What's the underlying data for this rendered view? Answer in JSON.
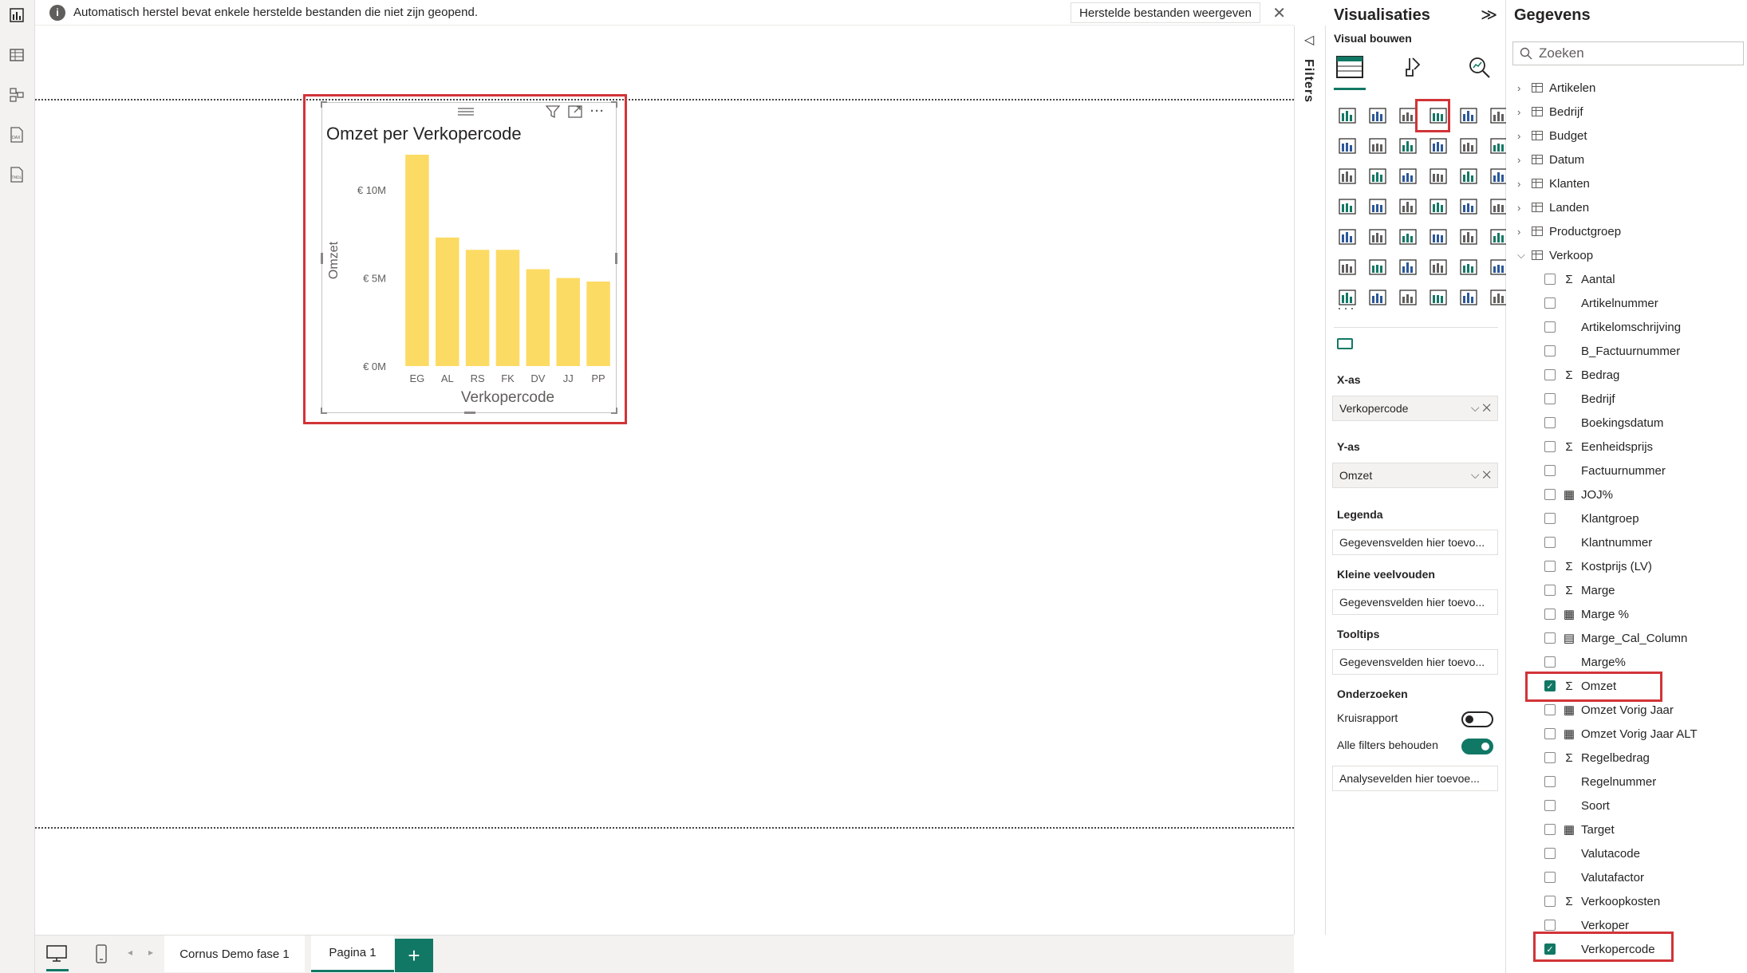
{
  "infobar": {
    "message": "Automatisch herstel bevat enkele herstelde bestanden die niet zijn geopend.",
    "restore_label": "Herstelde bestanden weergeven"
  },
  "visual": {
    "title": "Omzet per Verkopercode"
  },
  "chart_data": {
    "type": "bar",
    "title": "Omzet per Verkopercode",
    "xlabel": "Verkopercode",
    "ylabel": "Omzet",
    "categories": [
      "EG",
      "AL",
      "RS",
      "FK",
      "DV",
      "JJ",
      "PP"
    ],
    "values": [
      12000000,
      7300000,
      6600000,
      6600000,
      5500000,
      5000000,
      4800000
    ],
    "y_ticks": [
      "€ 0M",
      "€ 5M",
      "€ 10M"
    ],
    "ylim": [
      0,
      12000000
    ],
    "color": "#FCDB65",
    "grid": false
  },
  "filters": {
    "label": "Filters"
  },
  "visualizations": {
    "title": "Visualisaties",
    "subtitle": "Visual bouwen",
    "xaxis_label": "X-as",
    "xaxis_value": "Verkopercode",
    "yaxis_label": "Y-as",
    "yaxis_value": "Omzet",
    "legend_label": "Legenda",
    "legend_placeholder": "Gegevensvelden hier toevo...",
    "small_multiples_label": "Kleine veelvouden",
    "small_multiples_placeholder": "Gegevensvelden hier toevo...",
    "tooltips_label": "Tooltips",
    "tooltips_placeholder": "Gegevensvelden hier toevo...",
    "drill_label": "Onderzoeken",
    "cross_report_label": "Kruisrapport",
    "cross_report_on": false,
    "keep_filters_label": "Alle filters behouden",
    "keep_filters_on": true,
    "drill_placeholder": "Analysevelden hier toevoe..."
  },
  "data_pane": {
    "title": "Gegevens",
    "search_placeholder": "Zoeken",
    "tables": [
      "Artikelen",
      "Bedrijf",
      "Budget",
      "Datum",
      "Klanten",
      "Landen",
      "Productgroep"
    ],
    "expanded_table": "Verkoop",
    "fields": [
      {
        "name": "Aantal",
        "icon": "sum",
        "checked": false
      },
      {
        "name": "Artikelnummer",
        "icon": "none",
        "checked": false
      },
      {
        "name": "Artikelomschrijving",
        "icon": "none",
        "checked": false
      },
      {
        "name": "B_Factuurnummer",
        "icon": "none",
        "checked": false
      },
      {
        "name": "Bedrag",
        "icon": "sum",
        "checked": false
      },
      {
        "name": "Bedrijf",
        "icon": "none",
        "checked": false
      },
      {
        "name": "Boekingsdatum",
        "icon": "none",
        "checked": false
      },
      {
        "name": "Eenheidsprijs",
        "icon": "sum",
        "checked": false
      },
      {
        "name": "Factuurnummer",
        "icon": "none",
        "checked": false
      },
      {
        "name": "JOJ%",
        "icon": "calc",
        "checked": false
      },
      {
        "name": "Klantgroep",
        "icon": "none",
        "checked": false
      },
      {
        "name": "Klantnummer",
        "icon": "none",
        "checked": false
      },
      {
        "name": "Kostprijs (LV)",
        "icon": "sum",
        "checked": false
      },
      {
        "name": "Marge",
        "icon": "sum",
        "checked": false
      },
      {
        "name": "Marge %",
        "icon": "calc",
        "checked": false
      },
      {
        "name": "Marge_Cal_Column",
        "icon": "calccol",
        "checked": false
      },
      {
        "name": "Marge%",
        "icon": "none",
        "checked": false
      },
      {
        "name": "Omzet",
        "icon": "sum",
        "checked": true
      },
      {
        "name": "Omzet Vorig Jaar",
        "icon": "calc",
        "checked": false
      },
      {
        "name": "Omzet Vorig Jaar ALT",
        "icon": "calc",
        "checked": false
      },
      {
        "name": "Regelbedrag",
        "icon": "sum",
        "checked": false
      },
      {
        "name": "Regelnummer",
        "icon": "none",
        "checked": false
      },
      {
        "name": "Soort",
        "icon": "none",
        "checked": false
      },
      {
        "name": "Target",
        "icon": "calc",
        "checked": false
      },
      {
        "name": "Valutacode",
        "icon": "none",
        "checked": false
      },
      {
        "name": "Valutafactor",
        "icon": "none",
        "checked": false
      },
      {
        "name": "Verkoopkosten",
        "icon": "sum",
        "checked": false
      },
      {
        "name": "Verkoper",
        "icon": "none",
        "checked": false
      },
      {
        "name": "Verkopercode",
        "icon": "none",
        "checked": true
      }
    ]
  },
  "tabs": {
    "page1": "Cornus Demo fase 1",
    "page2": "Pagina 1",
    "add": "+"
  },
  "colors": {
    "accent": "#117865",
    "highlight": "#D13438",
    "bar": "#FCDB65"
  }
}
